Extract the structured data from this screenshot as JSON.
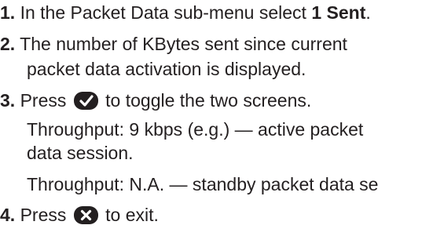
{
  "steps": [
    {
      "number": "1.",
      "text_before": "In the Packet Data sub-menu select ",
      "text_bold": "1 Sent",
      "text_after": "."
    },
    {
      "number": "2.",
      "line1": "The number of KBytes sent since current",
      "line2": "packet data activation is displayed."
    },
    {
      "number": "3.",
      "text_before": "Press",
      "icon": "ok-check-key-icon",
      "text_after": "to toggle the two screens.",
      "note1_line1": "Throughput: 9 kbps (e.g.) — active packet",
      "note1_line2": "data session.",
      "note2": "Throughput: N.A. — standby packet data se"
    },
    {
      "number": "4.",
      "text_before": "Press",
      "icon": "cancel-x-key-icon",
      "text_after": "to exit."
    }
  ],
  "colors": {
    "text": "#231f20",
    "key_fill": "#231f20",
    "key_glyph": "#ffffff"
  }
}
